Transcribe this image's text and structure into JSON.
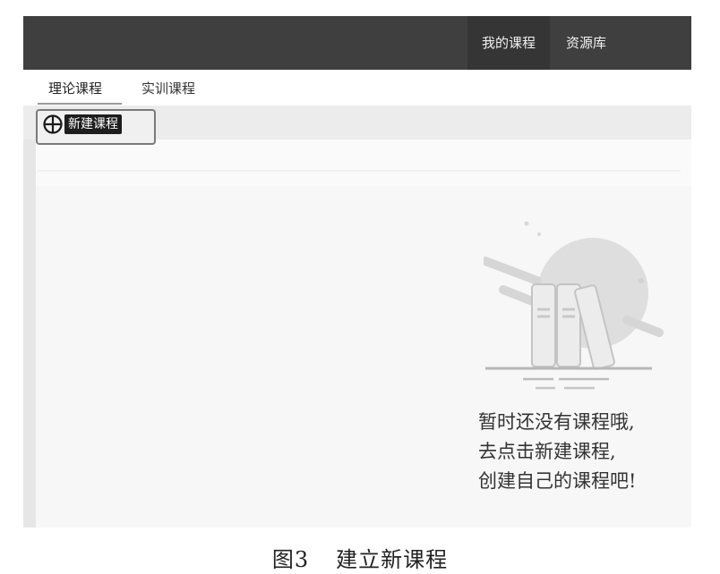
{
  "header": {
    "nav": [
      {
        "label": "我的课程"
      },
      {
        "label": "资源库"
      }
    ]
  },
  "tabs": [
    {
      "label": "理论课程"
    },
    {
      "label": "实训课程"
    }
  ],
  "toolbar": {
    "new_course_label": "新建课程"
  },
  "empty_state": {
    "lines": [
      "暂时还没有课程哦,",
      "去点击新建课程,",
      "创建自己的课程吧!"
    ]
  },
  "caption": {
    "number": "图3",
    "title": "建立新课程"
  }
}
